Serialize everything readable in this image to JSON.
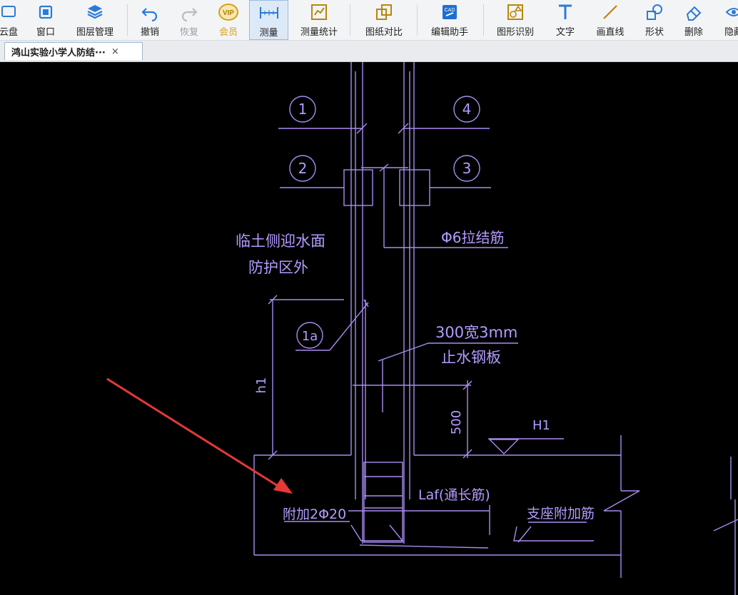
{
  "toolbar": {
    "items": [
      {
        "label": "云盘",
        "icon": "cloud-disk-icon"
      },
      {
        "label": "窗口",
        "icon": "window-icon"
      },
      {
        "label": "图层管理",
        "icon": "layers-icon"
      },
      {
        "label": "撤销",
        "icon": "undo-icon"
      },
      {
        "label": "恢复",
        "icon": "redo-icon"
      },
      {
        "label": "会员",
        "icon": "vip-icon"
      },
      {
        "label": "测量",
        "icon": "measure-icon"
      },
      {
        "label": "测量统计",
        "icon": "measure-stats-icon"
      },
      {
        "label": "图纸对比",
        "icon": "compare-icon"
      },
      {
        "label": "编辑助手",
        "icon": "cad-edit-icon"
      },
      {
        "label": "图形识别",
        "icon": "shape-recognize-icon"
      },
      {
        "label": "文字",
        "icon": "text-icon"
      },
      {
        "label": "画直线",
        "icon": "line-icon"
      },
      {
        "label": "形状",
        "icon": "shape-icon"
      },
      {
        "label": "删除",
        "icon": "eraser-icon"
      },
      {
        "label": "隐藏",
        "icon": "hide-icon"
      }
    ]
  },
  "tab": {
    "title": "鸿山实验小学人防结···",
    "close": "×"
  },
  "drawing": {
    "circle_labels": [
      "1",
      "4",
      "2",
      "3",
      "1a"
    ],
    "text_tie_bar": "Φ6拉结筋",
    "text_outside_line1": "临土侧迎水面",
    "text_outside_line2": "防护区外",
    "text_plate_line1": "300宽3mm",
    "text_plate_line2": "止水钢板",
    "dim_h1": "h1",
    "dim_500": "500",
    "level_h1": "H1",
    "text_laf": "Laf(通长筋)",
    "text_add_bar": "附加2Φ20",
    "text_support_bar": "支座附加筋"
  },
  "colors": {
    "line": "#a98cf0",
    "annotation": "#b49bff",
    "arrow": "#e53935",
    "background": "#000000",
    "toolbar_icon": "#2b7bd6",
    "vip": "#d4a017"
  }
}
